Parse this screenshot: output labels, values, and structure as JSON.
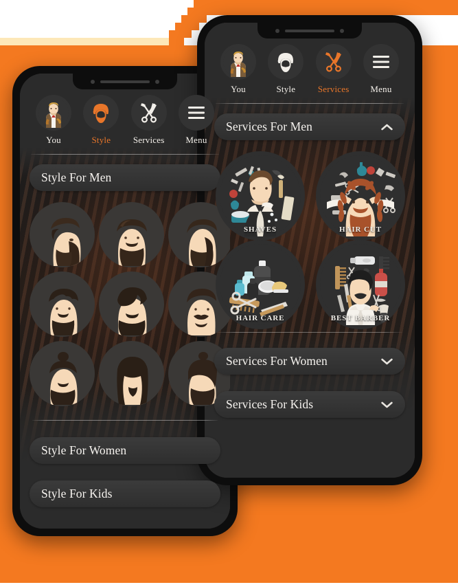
{
  "background": {
    "orange": "#f47920",
    "cream": "#fde8b8",
    "white": "#ffffff"
  },
  "theme": {
    "accent": "#e8762a",
    "screen_bg": "#2b2b2b",
    "card_bg": "#333333",
    "text": "#f3efe9"
  },
  "front_phone": {
    "nav": {
      "items": [
        {
          "label": "You",
          "icon": "barber-avatar-icon",
          "active": false
        },
        {
          "label": "Style",
          "icon": "bearded-face-icon",
          "active": false
        },
        {
          "label": "Services",
          "icon": "scissors-comb-icon",
          "active": true
        },
        {
          "label": "Menu",
          "icon": "hamburger-menu-icon",
          "active": false
        }
      ]
    },
    "sections": [
      {
        "title": "Services For Men",
        "expanded": true,
        "chevron": "chevron-up-icon"
      },
      {
        "title": "Services For Women",
        "expanded": false,
        "chevron": "chevron-down-icon"
      },
      {
        "title": "Services For Kids",
        "expanded": false,
        "chevron": "chevron-down-icon"
      }
    ],
    "services": [
      {
        "label": "SHAVES",
        "icon": "shaves-icon"
      },
      {
        "label": "HAIR CUT",
        "icon": "haircut-icon"
      },
      {
        "label": "HAIR CARE",
        "icon": "haircare-icon"
      },
      {
        "label": "BEST BARBER",
        "icon": "best-barber-icon"
      }
    ]
  },
  "back_phone": {
    "nav": {
      "items": [
        {
          "label": "You",
          "icon": "barber-avatar-icon",
          "active": false
        },
        {
          "label": "Style",
          "icon": "bearded-face-orange-icon",
          "active": true
        },
        {
          "label": "Services",
          "icon": "scissors-comb-white-icon",
          "active": false
        },
        {
          "label": "Menu",
          "icon": "hamburger-menu-icon",
          "active": false
        }
      ]
    },
    "sections": [
      {
        "title": "Style For Men",
        "expanded": true
      },
      {
        "title": "Style For Women",
        "expanded": false
      },
      {
        "title": "Style For Kids",
        "expanded": false
      }
    ],
    "styles": [
      {
        "name": "undercut-pompadour-beard"
      },
      {
        "name": "quiff-goatee"
      },
      {
        "name": "side-part-beard"
      },
      {
        "name": "wavy-top-short-beard"
      },
      {
        "name": "long-fringe-full-beard"
      },
      {
        "name": "slick-back-moustache"
      },
      {
        "name": "man-bun-beard"
      },
      {
        "name": "long-hair-goatee"
      },
      {
        "name": "top-knot-beard"
      }
    ]
  }
}
